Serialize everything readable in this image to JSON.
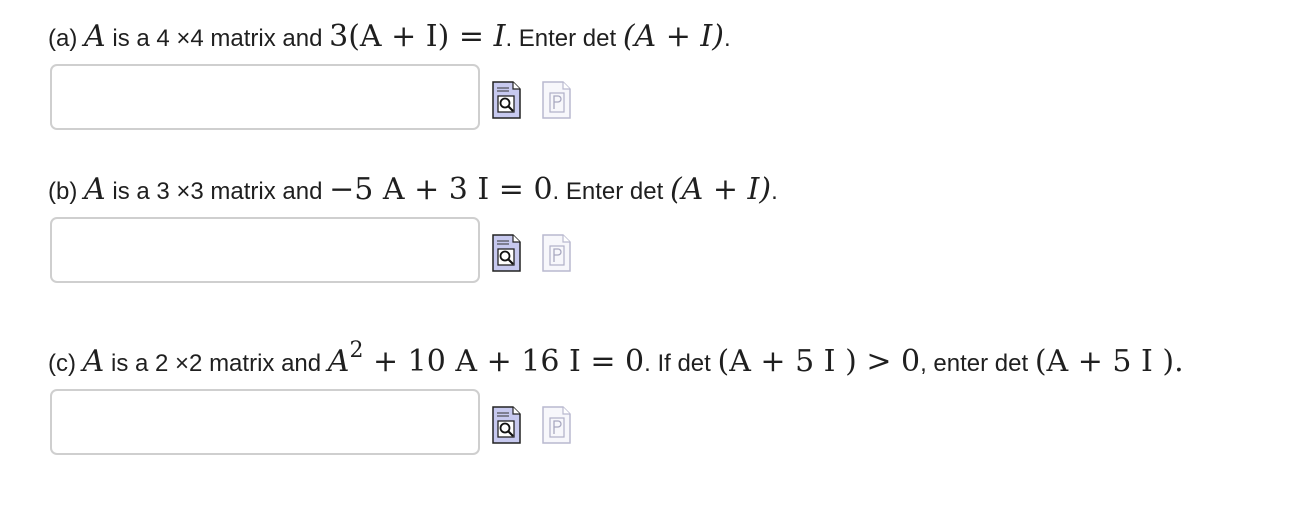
{
  "problems": [
    {
      "label": "(a)",
      "parts": {
        "A": "A",
        "is_a": " is a 4 ",
        "times": "×4 matrix and ",
        "eq": "3(A + I) = ",
        "I": "I",
        "enter": ". Enter det ",
        "det_expr": "(A + I)",
        "end": "."
      },
      "answer": {
        "value": "",
        "placeholder": ""
      }
    },
    {
      "label": "(b)",
      "parts": {
        "A": "A",
        "is_a": " is a 3 ",
        "times": "×3 matrix and ",
        "eq": "−5 A + 3 I = 0",
        "enter": ". Enter det ",
        "det_expr": "(A + I)",
        "end": "."
      },
      "answer": {
        "value": "",
        "placeholder": ""
      }
    },
    {
      "label": "(c)",
      "parts": {
        "A": "A",
        "is_a": " is a 2 ",
        "times": "×2 matrix and ",
        "eq_base": "A",
        "eq_exp": "2",
        "eq_rest": " + 10 A + 16 I = 0",
        "if_det": ". If det ",
        "cond_expr": "(A + 5 I ) > 0",
        "enter": ", enter det ",
        "det_expr": "(A + 5 I ).",
        "end": ""
      },
      "answer": {
        "value": "",
        "placeholder": ""
      }
    }
  ],
  "icons": {
    "preview": "preview-answer-icon",
    "pdf": "pdf-document-icon"
  }
}
